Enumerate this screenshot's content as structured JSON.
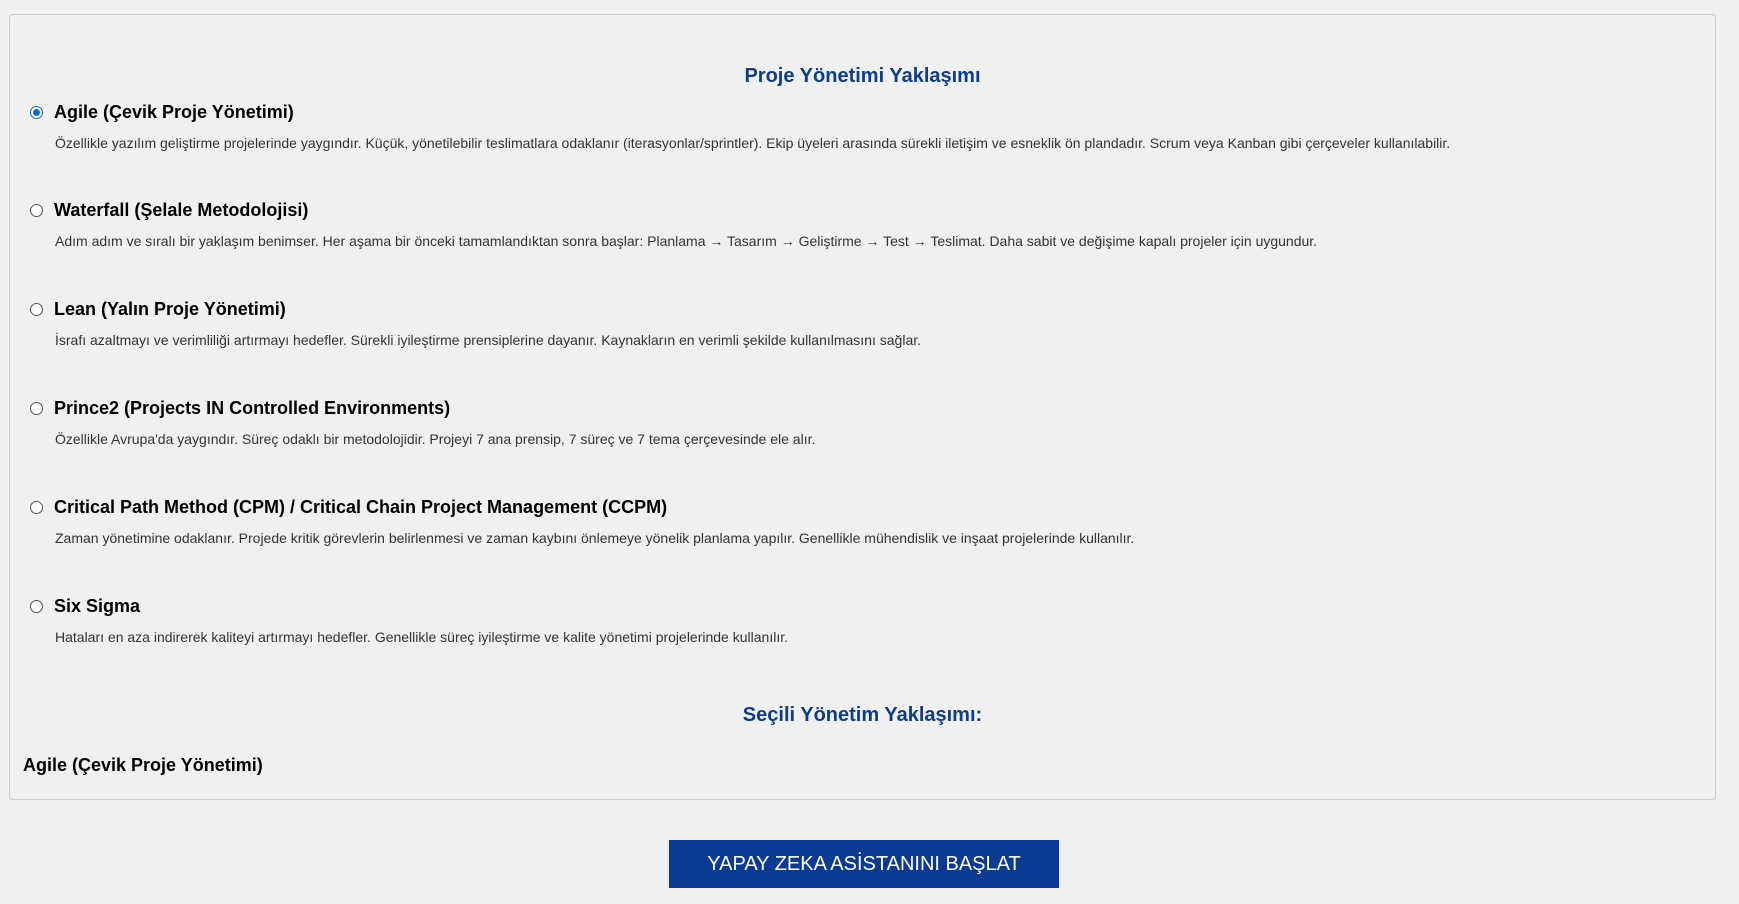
{
  "approach_title": "Proje Yönetimi Yaklaşımı",
  "options": [
    {
      "label": "Agile (Çevik Proje Yönetimi)",
      "description": "Özellikle yazılım geliştirme projelerinde yaygındır. Küçük, yönetilebilir teslimatlara odaklanır (iterasyonlar/sprintler). Ekip üyeleri arasında sürekli iletişim ve esneklik ön plandadır. Scrum veya Kanban gibi çerçeveler kullanılabilir.",
      "checked": true
    },
    {
      "label": "Waterfall (Şelale Metodolojisi)",
      "description": "Adım adım ve sıralı bir yaklaşım benimser. Her aşama bir önceki tamamlandıktan sonra başlar: Planlama → Tasarım → Geliştirme → Test → Teslimat. Daha sabit ve değişime kapalı projeler için uygundur.",
      "checked": false
    },
    {
      "label": "Lean (Yalın Proje Yönetimi)",
      "description": "İsrafı azaltmayı ve verimliliği artırmayı hedefler. Sürekli iyileştirme prensiplerine dayanır. Kaynakların en verimli şekilde kullanılmasını sağlar.",
      "checked": false
    },
    {
      "label": "Prince2 (Projects IN Controlled Environments)",
      "description": "Özellikle Avrupa'da yaygındır. Süreç odaklı bir metodolojidir. Projeyi 7 ana prensip, 7 süreç ve 7 tema çerçevesinde ele alır.",
      "checked": false
    },
    {
      "label": "Critical Path Method (CPM) / Critical Chain Project Management (CCPM)",
      "description": "Zaman yönetimine odaklanır. Projede kritik görevlerin belirlenmesi ve zaman kaybını önlemeye yönelik planlama yapılır. Genellikle mühendislik ve inşaat projelerinde kullanılır.",
      "checked": false
    },
    {
      "label": "Six Sigma",
      "description": "Hataları en aza indirerek kaliteyi artırmayı hedefler. Genellikle süreç iyileştirme ve kalite yönetimi projelerinde kullanılır.",
      "checked": false
    }
  ],
  "selected_title": "Seçili Yönetim Yaklaşımı:",
  "selected_value": "Agile (Çevik Proje Yönetimi)",
  "start_button_label": "YAPAY ZEKA ASİSTANINI BAŞLAT",
  "colors": {
    "accent": "#0b3d8c",
    "button_bg": "#0a3a93",
    "radio_checked": "#0a66e4"
  }
}
